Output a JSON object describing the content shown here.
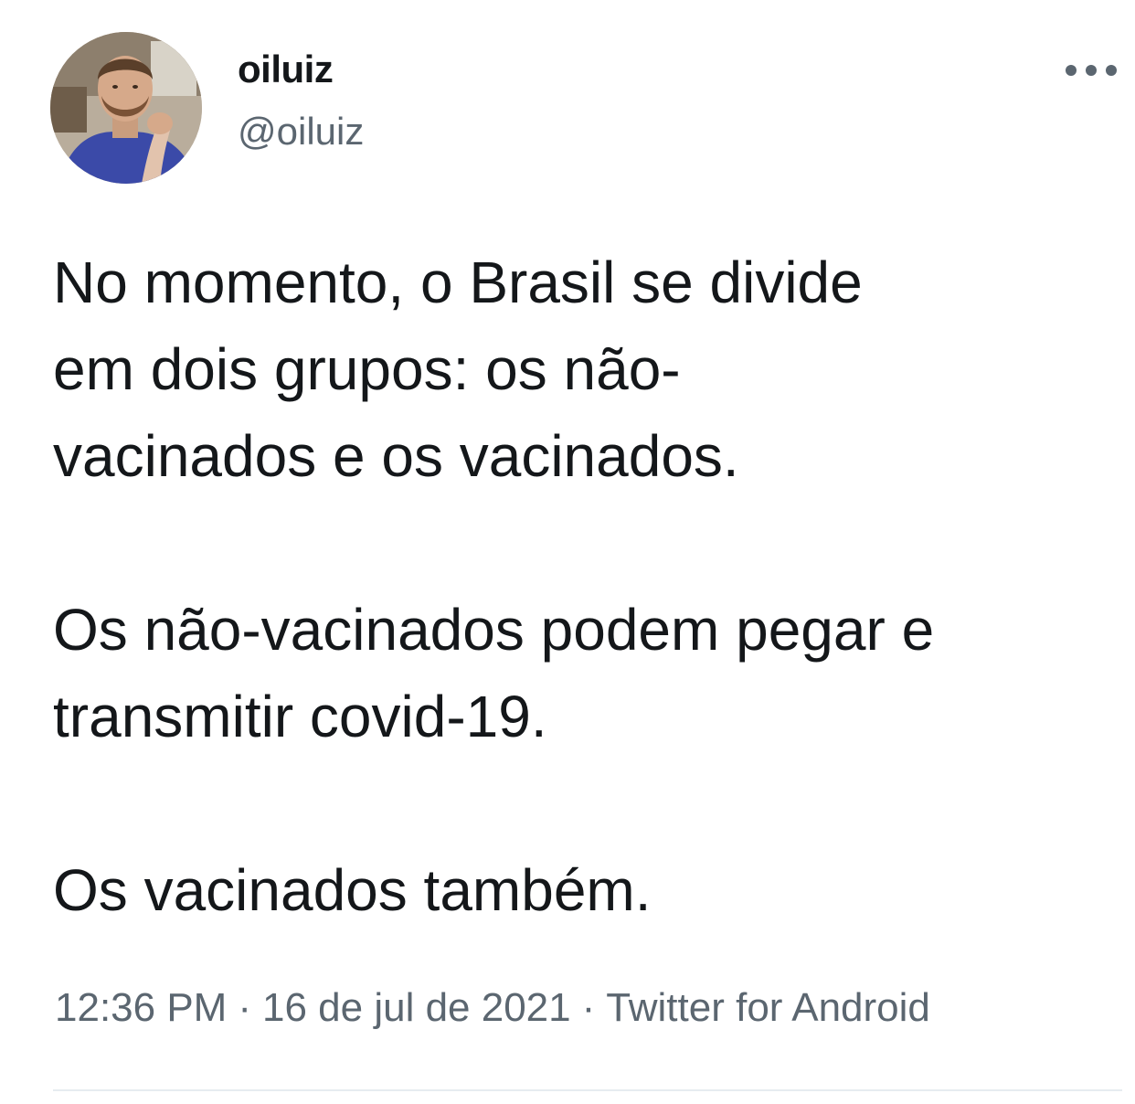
{
  "user": {
    "display_name": "oiluiz",
    "handle": "@oiluiz",
    "avatar_icon": "profile-photo"
  },
  "tweet": {
    "paragraphs": [
      "No momento, o Brasil se divide\nem dois grupos: os não-\nvacinados e os vacinados.",
      "Os não-vacinados podem pegar e\ntransmitir covid-19.",
      "Os vacinados também."
    ],
    "time": "12:36 PM",
    "separator": "·",
    "date": "16 de jul de 2021",
    "source": "Twitter for Android"
  },
  "colors": {
    "text": "#14171a",
    "secondary": "#5b6670",
    "divider": "#e6ecf0"
  },
  "icons": {
    "more": "more-horizontal-icon"
  }
}
